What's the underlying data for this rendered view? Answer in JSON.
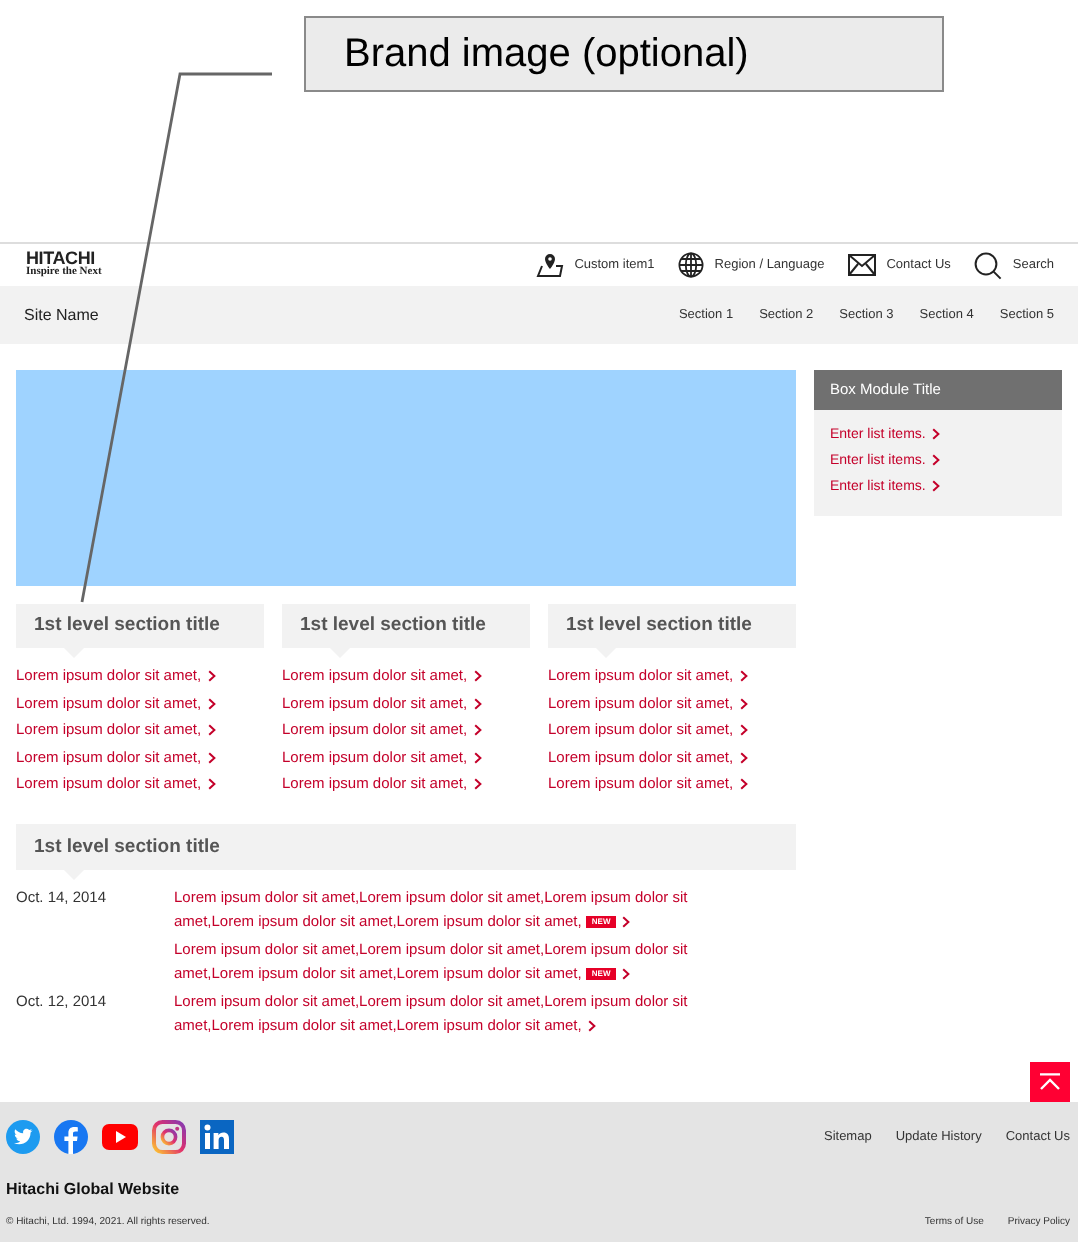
{
  "callout": {
    "label": "Brand image (optional)"
  },
  "header": {
    "logo": {
      "name": "HITACHI",
      "tagline": "Inspire the Next"
    },
    "utility_links": [
      {
        "kind": "pin",
        "label": "Custom item1"
      },
      {
        "kind": "globe",
        "label": "Region / Language"
      },
      {
        "kind": "mail",
        "label": "Contact Us"
      },
      {
        "kind": "search",
        "label": "Search"
      }
    ]
  },
  "nav": {
    "site_name": "Site Name",
    "sections": [
      "Section 1",
      "Section 2",
      "Section 3",
      "Section 4",
      "Section 5"
    ]
  },
  "box_module": {
    "title": "Box Module Title",
    "items": [
      "Enter list items.",
      "Enter list items.",
      "Enter list items."
    ]
  },
  "sections": [
    {
      "title": "1st level section title",
      "links": [
        "Lorem ipsum dolor sit amet,",
        "Lorem ipsum dolor sit amet,",
        "Lorem ipsum dolor sit amet,",
        "Lorem ipsum dolor sit amet,",
        "Lorem ipsum dolor sit amet,"
      ]
    },
    {
      "title": "1st level section title",
      "links": [
        "Lorem ipsum dolor sit amet,",
        "Lorem ipsum dolor sit amet,",
        "Lorem ipsum dolor sit amet,",
        "Lorem ipsum dolor sit amet,",
        "Lorem ipsum dolor sit amet,"
      ]
    },
    {
      "title": "1st level section title",
      "links": [
        "Lorem ipsum dolor sit amet,",
        "Lorem ipsum dolor sit amet,",
        "Lorem ipsum dolor sit amet,",
        "Lorem ipsum dolor sit amet,",
        "Lorem ipsum dolor sit amet,"
      ]
    }
  ],
  "news": {
    "title": "1st level section title",
    "items": [
      {
        "date": "Oct. 14, 2014",
        "text": "Lorem ipsum dolor sit amet,Lorem ipsum dolor sit amet,Lorem ipsum dolor sit amet,Lorem ipsum dolor sit amet,Lorem ipsum dolor sit amet,",
        "badge": "NEW"
      },
      {
        "text": "Lorem ipsum dolor sit amet,Lorem ipsum dolor sit amet,Lorem ipsum dolor sit amet,Lorem ipsum dolor sit amet,Lorem ipsum dolor sit amet,",
        "badge": "NEW"
      },
      {
        "date": "Oct. 12, 2014",
        "text": "Lorem ipsum dolor sit amet,Lorem ipsum dolor sit amet,Lorem ipsum dolor sit amet,Lorem ipsum dolor sit amet,Lorem ipsum dolor sit amet,"
      }
    ]
  },
  "footer": {
    "social": [
      {
        "kind": "twitter"
      },
      {
        "kind": "facebook"
      },
      {
        "kind": "youtube"
      },
      {
        "kind": "instagram"
      },
      {
        "kind": "linkedin"
      }
    ],
    "links": [
      "Sitemap",
      "Update History",
      "Contact Us"
    ],
    "site_title": "Hitachi Global Website",
    "copyright": "© Hitachi, Ltd. 1994, 2021. All rights reserved.",
    "legal_links": [
      "Terms of Use",
      "Privacy Policy"
    ]
  }
}
